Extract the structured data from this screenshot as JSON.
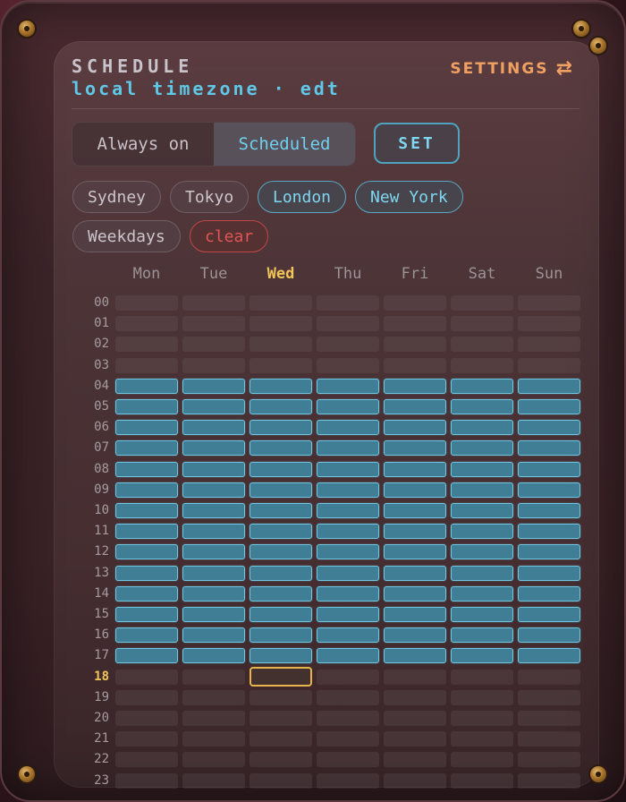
{
  "header": {
    "title": "SCHEDULE",
    "subtitle": "local timezone · edt",
    "settings_label": "SETTINGS",
    "settings_icon": "swap-arrows-icon"
  },
  "mode": {
    "options": [
      "Always on",
      "Scheduled"
    ],
    "selected": "Scheduled",
    "set_label": "SET"
  },
  "presets": {
    "cities": [
      "Sydney",
      "Tokyo",
      "London",
      "New York"
    ],
    "active_cities": [
      "London",
      "New York"
    ],
    "weekdays_label": "Weekdays",
    "clear_label": "clear"
  },
  "grid": {
    "days": [
      "Mon",
      "Tue",
      "Wed",
      "Thu",
      "Fri",
      "Sat",
      "Sun"
    ],
    "today": "Wed",
    "hours": [
      "00",
      "01",
      "02",
      "03",
      "04",
      "05",
      "06",
      "07",
      "08",
      "09",
      "10",
      "11",
      "12",
      "13",
      "14",
      "15",
      "16",
      "17",
      "18",
      "19",
      "20",
      "21",
      "22",
      "23"
    ],
    "current_hour": "18",
    "active_start_hour": 4,
    "active_end_hour": 17
  },
  "colors": {
    "accent_cyan": "#5fc8e6",
    "accent_orange": "#f0a060",
    "today_gold": "#f2c45a",
    "clear_red": "#e05555"
  }
}
